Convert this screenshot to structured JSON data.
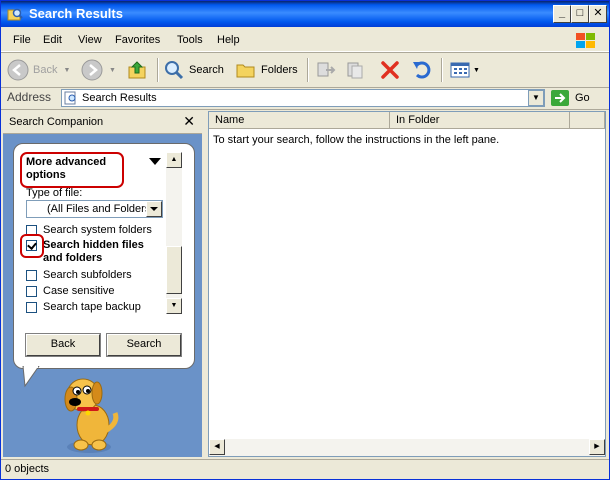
{
  "window": {
    "title": "Search Results",
    "controls": {
      "minimize": "_",
      "maximize": "□",
      "close": "✕"
    }
  },
  "menu": [
    "File",
    "Edit",
    "View",
    "Favorites",
    "Tools",
    "Help"
  ],
  "toolbar": {
    "back": "Back",
    "search": "Search",
    "folders": "Folders"
  },
  "address": {
    "label": "Address",
    "value": "Search Results",
    "go": "Go"
  },
  "search_companion": {
    "title": "Search Companion",
    "close": "✕",
    "advanced_title": "More advanced options",
    "type_label": "Type of file:",
    "type_value": "(All Files and Folders)",
    "options": [
      {
        "label": "Search system folders",
        "checked": false
      },
      {
        "label": "Search hidden files and folders",
        "checked": true
      },
      {
        "label": "Search subfolders",
        "checked": false
      },
      {
        "label": "Case sensitive",
        "checked": false
      },
      {
        "label": "Search tape backup",
        "checked": false
      }
    ],
    "back_button": "Back",
    "search_button": "Search"
  },
  "results": {
    "columns": [
      "Name",
      "In Folder"
    ],
    "empty_message": "To start your search, follow the instructions in the left pane."
  },
  "status": {
    "text": "0 objects"
  },
  "colors": {
    "title_bar": "#0058ee",
    "highlight": "#cc0000",
    "companion_bg": "#6a92c8"
  }
}
